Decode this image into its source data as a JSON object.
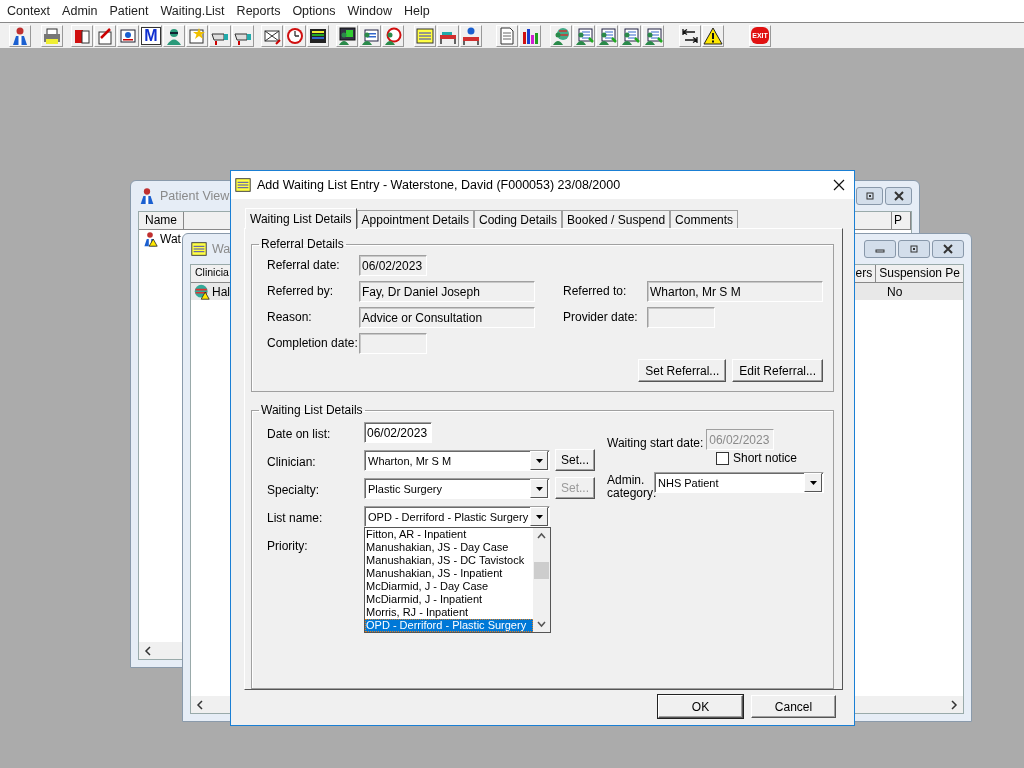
{
  "menu_bar": [
    "Context",
    "Admin",
    "Patient",
    "Waiting.List",
    "Reports",
    "Options",
    "Window",
    "Help"
  ],
  "toolbar": {
    "mail_icon_text": "M",
    "exit_sign_text": "EXIT"
  },
  "patient_view_window": {
    "title": "Patient View",
    "columns": [
      "Name",
      "P"
    ],
    "row_cell": "Wat"
  },
  "waiting_list_window": {
    "title": "Wa",
    "left_column": "Clinicia",
    "left_row_cell": "Hal",
    "right_columns": [
      "ers",
      "Suspension Pe"
    ],
    "right_row_cell": "No"
  },
  "dialog": {
    "title": "Add Waiting List Entry - Waterstone, David (F000053) 23/08/2000",
    "tabs": [
      {
        "label": "Waiting List Details",
        "selected": true
      },
      {
        "label": "Appointment Details",
        "selected": false
      },
      {
        "label": "Coding Details",
        "selected": false
      },
      {
        "label": "Booked / Suspend",
        "selected": false
      },
      {
        "label": "Comments",
        "selected": false
      }
    ],
    "referral_details": {
      "title": "Referral Details",
      "fields": [
        {
          "label": "Referral date:",
          "value": "06/02/2023",
          "read_only": true
        },
        {
          "label": "Referred by:",
          "value": "Fay, Dr Daniel Joseph",
          "read_only": true
        },
        {
          "label": "Referred to:",
          "value": "Wharton, Mr S M",
          "read_only": true
        },
        {
          "label": "Reason:",
          "value": "Advice or Consultation",
          "read_only": true
        },
        {
          "label": "Provider date:",
          "read_only": true
        },
        {
          "label": "Completion date:",
          "read_only": true
        }
      ],
      "buttons": [
        "Set Referral...",
        "Edit Referral..."
      ]
    },
    "waiting_list_details": {
      "title": "Waiting List Details",
      "date_on_list": {
        "label": "Date on list:",
        "value": "06/02/2023"
      },
      "clinician": {
        "label": "Clinician:",
        "value": "Wharton, Mr S M",
        "set_button": {
          "label": "Set...",
          "disabled": false
        }
      },
      "specialty": {
        "label": "Specialty:",
        "value": "Plastic Surgery",
        "set_button": {
          "label": "Set...",
          "disabled": true
        }
      },
      "list_name": {
        "label": "List name:",
        "value": "OPD - Derriford - Plastic Surgery",
        "expanded": true,
        "options": [
          {
            "label": "Fitton, AR - Inpatient",
            "selected": false
          },
          {
            "label": "Manushakian, JS - Day Case",
            "selected": false
          },
          {
            "label": "Manushakian, JS - DC Tavistock",
            "selected": false
          },
          {
            "label": "Manushakian, JS - Inpatient",
            "selected": false
          },
          {
            "label": "McDiarmid, J - Day Case",
            "selected": false
          },
          {
            "label": "McDiarmid, J - Inpatient",
            "selected": false
          },
          {
            "label": "Morris, RJ - Inpatient",
            "selected": false
          },
          {
            "label": "OPD - Derriford - Plastic Surgery",
            "selected": true
          }
        ]
      },
      "priority": {
        "label": "Priority:"
      },
      "waiting_start_date": {
        "label": "Waiting start date:",
        "value": "06/02/2023",
        "disabled": true
      },
      "short_notice": {
        "label": "Short notice",
        "checked": false
      },
      "admin_category": {
        "label": "Admin. category:",
        "value": "NHS Patient"
      }
    },
    "buttons": [
      {
        "label": "OK",
        "default": true
      },
      {
        "label": "Cancel",
        "default": false
      }
    ]
  }
}
